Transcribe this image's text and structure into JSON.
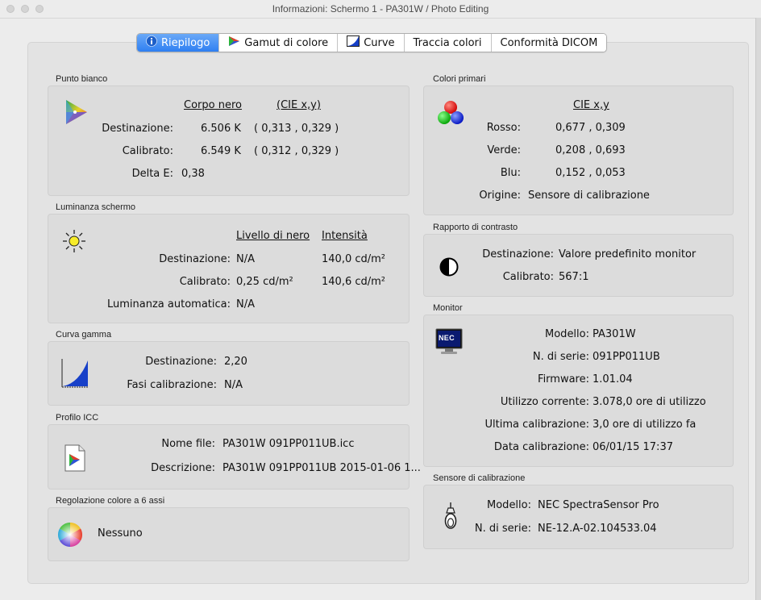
{
  "window": {
    "title": "Informazioni: Schermo 1 - PA301W / Photo Editing"
  },
  "tabs": [
    {
      "label": "Riepilogo",
      "icon": "info-icon",
      "active": true
    },
    {
      "label": "Gamut di colore",
      "icon": "gamut-triangle-icon"
    },
    {
      "label": "Curve",
      "icon": "curve-icon"
    },
    {
      "label": "Traccia colori"
    },
    {
      "label": "Conformità DICOM"
    }
  ],
  "white_point": {
    "title": "Punto bianco",
    "col_blackbody": "Corpo nero",
    "col_cie": "(CIE x,y)",
    "target_label": "Destinazione:",
    "target_k": "6.506 K",
    "target_xy": "( 0,313 , 0,329 )",
    "calibrated_label": "Calibrato:",
    "calibrated_k": "6.549 K",
    "calibrated_xy": "( 0,312 , 0,329 )",
    "delta_label": "Delta E:",
    "delta_value": "0,38"
  },
  "luminance": {
    "title": "Luminanza schermo",
    "col_black": "Livello di nero",
    "col_intensity": "Intensità",
    "target_label": "Destinazione:",
    "target_black": "N/A",
    "target_intensity": "140,0 cd/m²",
    "calibrated_label": "Calibrato:",
    "calibrated_black": "0,25 cd/m²",
    "calibrated_intensity": "140,6 cd/m²",
    "auto_label": "Luminanza automatica:",
    "auto_value": "N/A"
  },
  "gamma": {
    "title": "Curva gamma",
    "target_label": "Destinazione:",
    "target_value": "2,20",
    "steps_label": "Fasi calibrazione:",
    "steps_value": "N/A"
  },
  "icc": {
    "title": "Profilo ICC",
    "file_label": "Nome file:",
    "file_value": "PA301W 091PP011UB.icc",
    "desc_label": "Descrizione:",
    "desc_value": "PA301W 091PP011UB 2015-01-06 1..."
  },
  "six_axis": {
    "title": "Regolazione colore a 6 assi",
    "value": "Nessuno"
  },
  "primaries": {
    "title": "Colori primari",
    "col_cie": "CIE x,y",
    "red_label": "Rosso:",
    "red_value": "0,677 , 0,309",
    "green_label": "Verde:",
    "green_value": "0,208 , 0,693",
    "blue_label": "Blu:",
    "blue_value": "0,152 , 0,053",
    "origin_label": "Origine:",
    "origin_value": "Sensore di calibrazione"
  },
  "contrast": {
    "title": "Rapporto di contrasto",
    "target_label": "Destinazione:",
    "target_value": "Valore predefinito monitor",
    "calibrated_label": "Calibrato:",
    "calibrated_value": "567:1"
  },
  "monitor": {
    "title": "Monitor",
    "logo_text": "NEC",
    "model_label": "Modello:",
    "model_value": "PA301W",
    "serial_label": "N. di serie:",
    "serial_value": "091PP011UB",
    "firmware_label": "Firmware:",
    "firmware_value": "1.01.04",
    "usage_label": "Utilizzo corrente:",
    "usage_value": "3.078,0 ore di utilizzo",
    "lastcal_label": "Ultima calibrazione:",
    "lastcal_value": "3,0 ore di utilizzo fa",
    "caldate_label": "Data calibrazione:",
    "caldate_value": "06/01/15 17:37"
  },
  "sensor": {
    "title": "Sensore di calibrazione",
    "model_label": "Modello:",
    "model_value": "NEC SpectraSensor Pro",
    "serial_label": "N. di serie:",
    "serial_value": "NE-12.A-02.104533.04"
  }
}
